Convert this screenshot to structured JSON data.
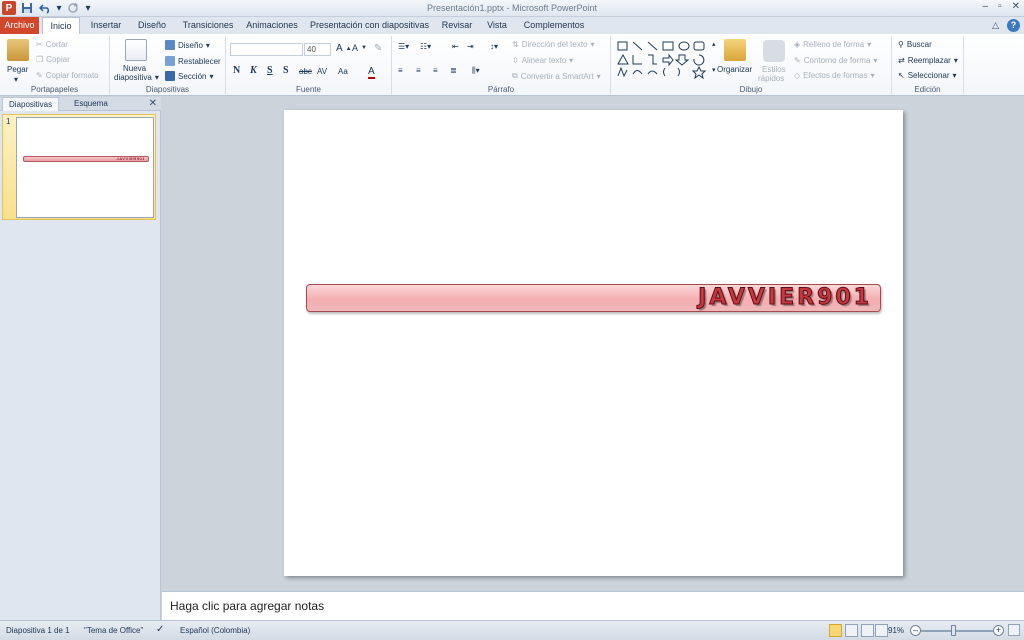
{
  "window": {
    "title": "Presentación1.pptx - Microsoft PowerPoint",
    "qat_icons": [
      "powerpoint-logo",
      "save-icon",
      "undo-icon",
      "redo-icon",
      "customize-icon"
    ]
  },
  "tabs": [
    "Archivo",
    "Inicio",
    "Insertar",
    "Diseño",
    "Transiciones",
    "Animaciones",
    "Presentación con diapositivas",
    "Revisar",
    "Vista",
    "Complementos"
  ],
  "ribbon": {
    "portapapeles": {
      "label": "Portapapeles",
      "paste": "Pegar",
      "cut": "Cortar",
      "copy": "Copiar",
      "format_painter": "Copiar formato"
    },
    "diapositivas": {
      "label": "Diapositivas",
      "new_slide_1": "Nueva",
      "new_slide_2": "diapositiva",
      "layout": "Diseño",
      "reset": "Restablecer",
      "section": "Sección"
    },
    "fuente": {
      "label": "Fuente",
      "font_name": "",
      "font_size": "40",
      "bold": "N",
      "italic": "K",
      "underline": "S",
      "shadow": "S",
      "strike": "abc",
      "spacing": "AV",
      "case": "Aa",
      "color": "A"
    },
    "parrafo": {
      "label": "Párrafo",
      "text_direction": "Dirección del texto",
      "align_text": "Alinear texto",
      "smartart": "Convertir a SmartArt"
    },
    "dibujo": {
      "label": "Dibujo",
      "arrange": "Organizar",
      "quick_styles_1": "Estilos",
      "quick_styles_2": "rápidos",
      "fill": "Relleno de forma",
      "outline": "Contorno de forma",
      "effects": "Efectos de formas"
    },
    "edicion": {
      "label": "Edición",
      "find": "Buscar",
      "replace": "Reemplazar",
      "select": "Seleccionar"
    }
  },
  "left_panel": {
    "tab_slides": "Diapositivas",
    "tab_outline": "Esquema",
    "slide_number": "1",
    "thumb_text": "JAVVIER901"
  },
  "slide": {
    "title_text": "JAVVIER901"
  },
  "notes": {
    "placeholder": "Haga clic para agregar notas"
  },
  "status": {
    "slide_info": "Diapositiva 1 de 1",
    "theme": "\"Tema de Office\"",
    "language": "Español (Colombia)",
    "zoom": "91%"
  }
}
